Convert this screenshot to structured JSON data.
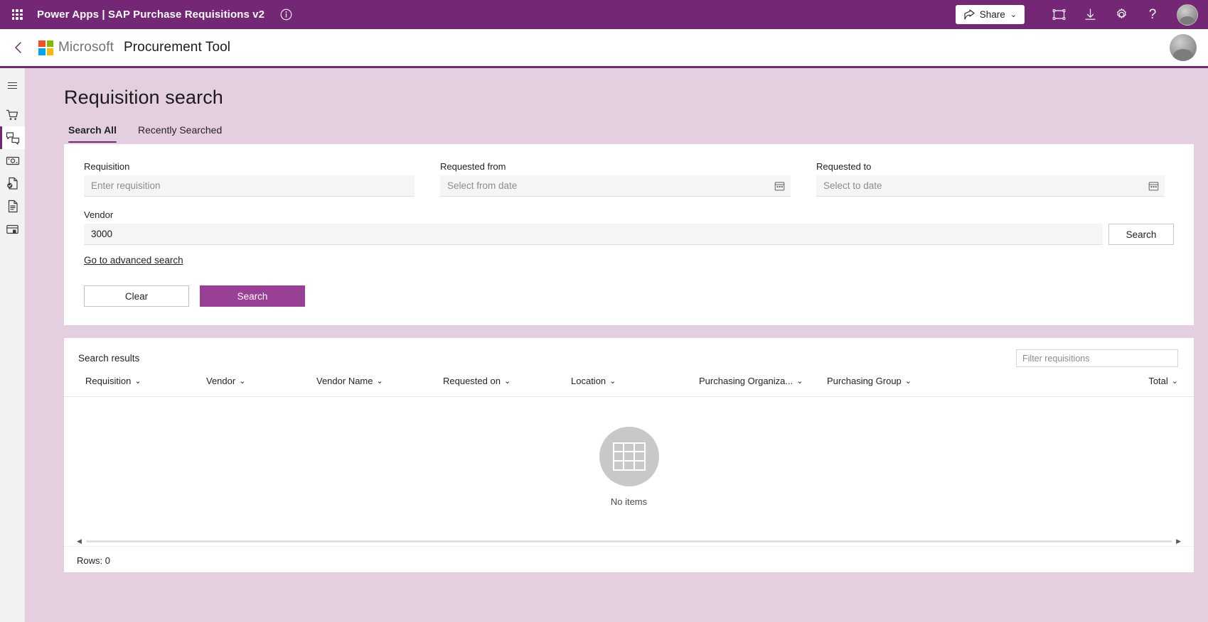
{
  "topbar": {
    "waffle_label": "app-launcher",
    "title": "Power Apps  |  SAP Purchase Requisitions v2",
    "info_label": "i",
    "share_label": "Share",
    "share_caret": "⌄",
    "icons": [
      "fullscreen-icon",
      "download-icon",
      "settings-icon",
      "help-icon"
    ],
    "help_label": "?"
  },
  "appheader": {
    "back_label": "‹",
    "microsoft": "Microsoft",
    "app_name": "Procurement Tool"
  },
  "rail": {
    "items": [
      {
        "name": "menu-icon",
        "label": "Menu"
      },
      {
        "name": "cart-icon",
        "label": "Shopping cart"
      },
      {
        "name": "approvals-icon",
        "label": "Approvals"
      },
      {
        "name": "money-icon",
        "label": "Invoices"
      },
      {
        "name": "document-check-icon",
        "label": "Confirmations"
      },
      {
        "name": "document-lines-icon",
        "label": "Requisitions"
      },
      {
        "name": "archive-icon",
        "label": "Archive"
      }
    ],
    "selected_index": 2
  },
  "page": {
    "title": "Requisition search",
    "tabs": [
      {
        "label": "Search All",
        "active": true
      },
      {
        "label": "Recently Searched",
        "active": false
      }
    ]
  },
  "search_form": {
    "requisition": {
      "label": "Requisition",
      "value": "",
      "placeholder": "Enter requisition"
    },
    "requested_from": {
      "label": "Requested from",
      "value": "",
      "placeholder": "Select from date",
      "icon": "calendar-icon"
    },
    "requested_to": {
      "label": "Requested to",
      "value": "",
      "placeholder": "Select to date",
      "icon": "calendar-icon"
    },
    "vendor": {
      "label": "Vendor",
      "value": "3000",
      "placeholder": ""
    },
    "vendor_search_label": "Search",
    "advanced_link": "Go to advanced search",
    "clear_label": "Clear",
    "search_label": "Search"
  },
  "results": {
    "title": "Search results",
    "filter_placeholder": "Filter requisitions",
    "columns": [
      "Requisition",
      "Vendor",
      "Vendor Name",
      "Requested on",
      "Location",
      "Purchasing Organiza...",
      "Purchasing Group",
      "Total"
    ],
    "sort_caret": "⌄",
    "empty_text": "No items",
    "rows_label": "Rows: 0",
    "scroll_left": "◀",
    "scroll_right": "▶"
  },
  "colors": {
    "brand_purple": "#742774",
    "accent_purple": "#9a3f96",
    "page_bg": "#e3cfe0"
  }
}
